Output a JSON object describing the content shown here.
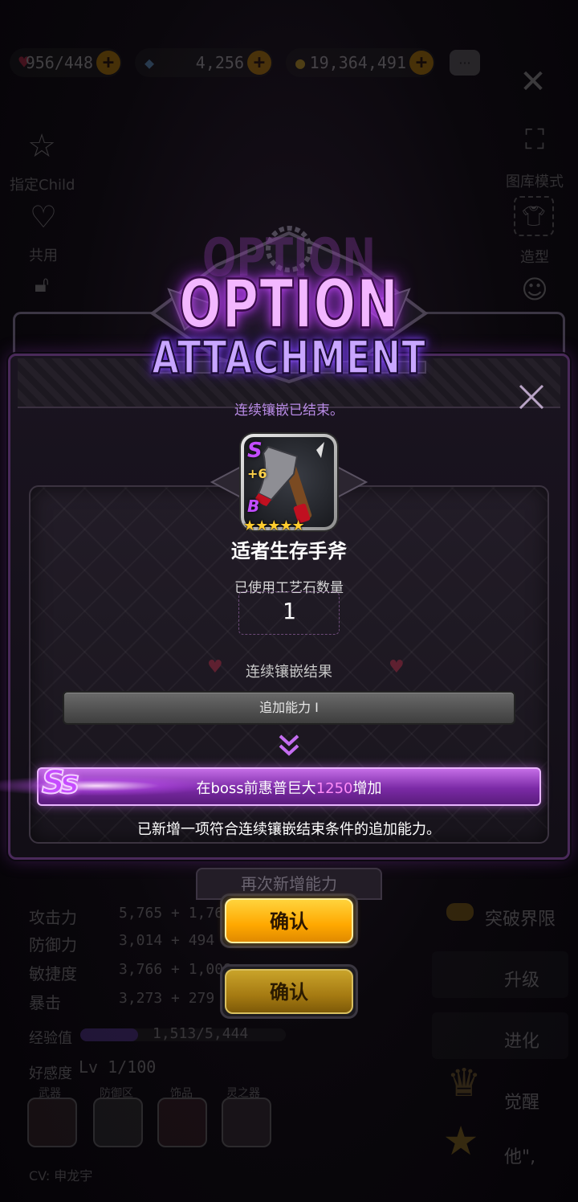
{
  "background": {
    "topbar": {
      "hearts": "956/448",
      "crystals": "4,256",
      "coins": "19,364,491"
    },
    "left_menu": [
      {
        "label": "指定Child",
        "icon": "star-icon"
      },
      {
        "label": "共用",
        "icon": "heart-icon"
      }
    ],
    "right_menu": [
      {
        "label": "图库模式",
        "icon": "fullscreen-icon"
      },
      {
        "label": "造型",
        "icon": "shirt-icon"
      }
    ],
    "stats": [
      {
        "label": "攻击力",
        "value": "5,765 + 1,763"
      },
      {
        "label": "防御力",
        "value": "3,014 + 494"
      },
      {
        "label": "敏捷度",
        "value": "3,766 + 1,008"
      },
      {
        "label": "暴击",
        "value": "3,273 + 279"
      }
    ],
    "exp_label": "经验值",
    "exp_value": "1,513/5,444",
    "affinity_label": "好感度",
    "affinity_value": "Lv 1/100",
    "equip_tabs": [
      "武器",
      "防御区",
      "饰品",
      "灵之器"
    ],
    "cv": "CV: 申龙宇",
    "right_actions": [
      "突破界限",
      "升级",
      "进化",
      "觉醒",
      "他\","
    ],
    "hidden_button": "再次新增能力"
  },
  "dialog": {
    "logo_line1": "OPTION",
    "logo_line2": "ATTACHMENT",
    "status": "连续镶嵌已结束。",
    "item": {
      "grade_top": "S",
      "enhance": "+6",
      "grade_bottom": "B",
      "stars": "★★★★★",
      "name": "适者生存手斧"
    },
    "craft_label": "已使用工艺石数量",
    "craft_value": "1",
    "result_label": "连续镶嵌结果",
    "before_option": "追加能力 I",
    "after_badge": "Ss",
    "after_option_pre": "在boss前惠普巨大",
    "after_option_num": "1250",
    "after_option_post": "增加",
    "notice": "已新增一项符合连续镶嵌结束条件的追加能力。",
    "confirm_primary": "确认",
    "confirm_secondary": "确认"
  },
  "colors": {
    "accent_purple": "#c64cff",
    "confirm_yellow": "#ffb000",
    "highlight_pink": "#ff8cf8"
  }
}
